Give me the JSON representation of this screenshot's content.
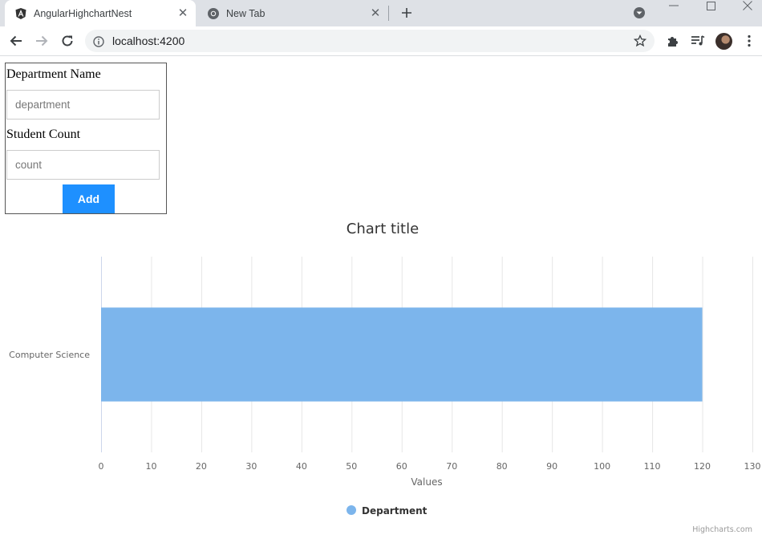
{
  "browser": {
    "tabs": [
      {
        "title": "AngularHighchartNest",
        "active": true
      },
      {
        "title": "New Tab",
        "active": false
      }
    ],
    "url": "localhost:4200"
  },
  "form": {
    "department_label": "Department Name",
    "department_placeholder": "department",
    "count_label": "Student Count",
    "count_placeholder": "count",
    "add_label": "Add"
  },
  "colors": {
    "bar": "#7cb5ec",
    "button": "#1e90ff"
  },
  "chart_data": {
    "type": "bar",
    "orientation": "horizontal",
    "title": "Chart title",
    "categories": [
      "Computer Science"
    ],
    "series": [
      {
        "name": "Department",
        "values": [
          120
        ]
      }
    ],
    "xlabel": "Values",
    "ylabel": "",
    "xlim": [
      0,
      130
    ],
    "ticks": [
      0,
      10,
      20,
      30,
      40,
      50,
      60,
      70,
      80,
      90,
      100,
      110,
      120,
      130
    ],
    "grid": true,
    "legend": "bottom-center",
    "credits": "Highcharts.com"
  }
}
